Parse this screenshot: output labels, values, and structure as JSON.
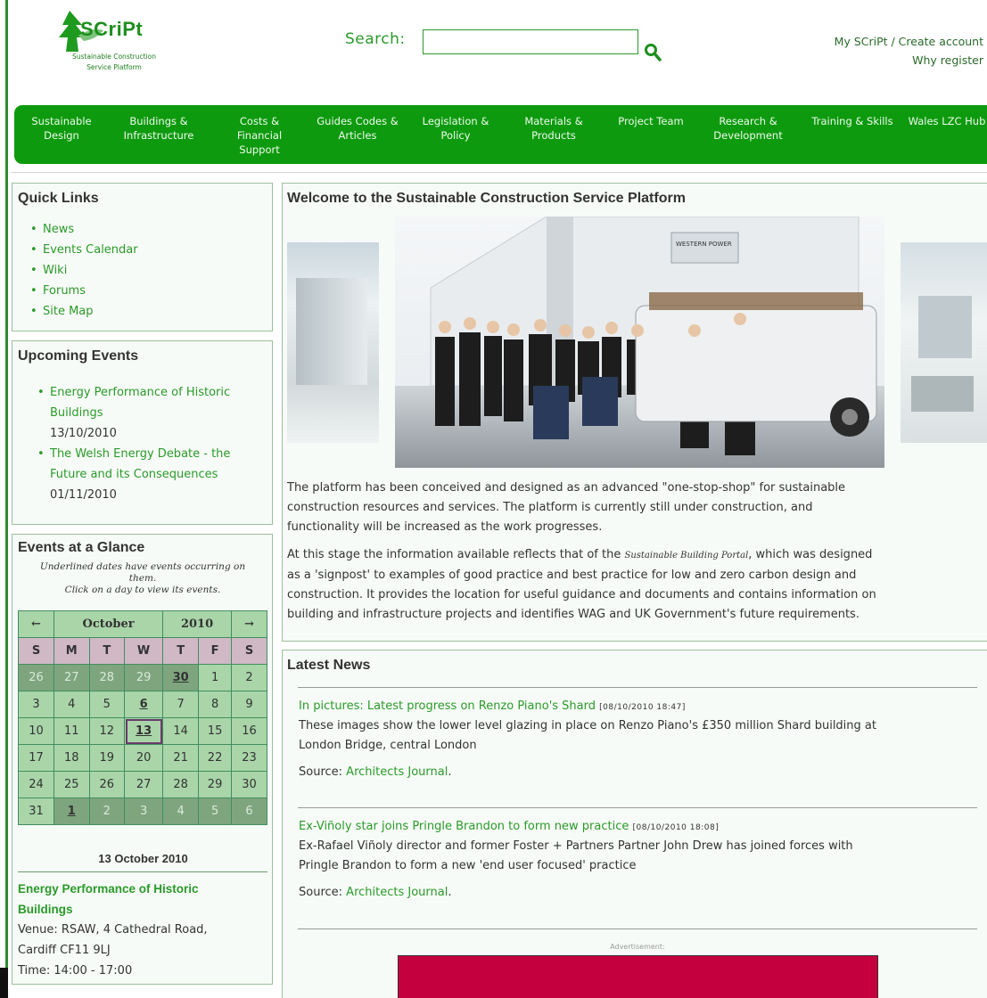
{
  "header": {
    "logo_text": "SCriPt",
    "logo_sub_line1": "Sustainable Construction",
    "logo_sub_line2": "Service Platform",
    "search_label": "Search:",
    "search_value": "",
    "account_links": "My SCriPt / Create account",
    "why_register": "Why register"
  },
  "nav": {
    "items": [
      {
        "line1": "Sustainable",
        "line2": "Design",
        "line3": ""
      },
      {
        "line1": "Buildings &",
        "line2": "Infrastructure",
        "line3": ""
      },
      {
        "line1": "Costs &",
        "line2": "Financial",
        "line3": "Support"
      },
      {
        "line1": "Guides Codes &",
        "line2": "Articles",
        "line3": ""
      },
      {
        "line1": "Legislation &",
        "line2": "Policy",
        "line3": ""
      },
      {
        "line1": "Materials &",
        "line2": "Products",
        "line3": ""
      },
      {
        "line1": "Project Team",
        "line2": "",
        "line3": ""
      },
      {
        "line1": "Research &",
        "line2": "Development",
        "line3": ""
      },
      {
        "line1": "Training & Skills",
        "line2": "",
        "line3": ""
      },
      {
        "line1": "Wales LZC Hub",
        "line2": "",
        "line3": ""
      }
    ]
  },
  "quick_links": {
    "title": "Quick Links",
    "items": [
      "News",
      "Events Calendar",
      "Wiki",
      "Forums",
      "Site Map"
    ]
  },
  "upcoming": {
    "title": "Upcoming Events",
    "events": [
      {
        "line1": "Energy Performance of Historic",
        "line2": "Buildings",
        "date": "13/10/2010"
      },
      {
        "line1": "The Welsh Energy Debate - the",
        "line2": "Future and its Consequences",
        "date": "01/11/2010"
      }
    ]
  },
  "glance": {
    "title": "Events at a Glance",
    "hint_line1": "Underlined dates have events occurring on",
    "hint_line2": "them.",
    "hint_line3": "Click on a day to view its events.",
    "prev": "←",
    "next": "→",
    "month": "October",
    "year": "2010",
    "dow": [
      "S",
      "M",
      "T",
      "W",
      "T",
      "F",
      "S"
    ],
    "weeks": [
      [
        "26",
        "27",
        "28",
        "29",
        "30",
        "1",
        "2"
      ],
      [
        "3",
        "4",
        "5",
        "6",
        "7",
        "8",
        "9"
      ],
      [
        "10",
        "11",
        "12",
        "13",
        "14",
        "15",
        "16"
      ],
      [
        "17",
        "18",
        "19",
        "20",
        "21",
        "22",
        "23"
      ],
      [
        "24",
        "25",
        "26",
        "27",
        "28",
        "29",
        "30"
      ],
      [
        "31",
        "1",
        "2",
        "3",
        "4",
        "5",
        "6"
      ]
    ],
    "selected_date": "13 October 2010",
    "event_title_line1": "Energy Performance of Historic",
    "event_title_line2": "Buildings",
    "venue_line1": "Venue: RSAW, 4 Cathedral Road,",
    "venue_line2": "Cardiff CF11 9LJ",
    "time": "Time: 14:00 - 17:00"
  },
  "welcome": {
    "title": "Welcome to the Sustainable Construction Service Platform",
    "p1_l1": "The platform has been conceived and designed as an advanced \"one-stop-shop\" for sustainable",
    "p1_l2": "construction resources and services. The platform is currently still under construction, and",
    "p1_l3": "functionality will be increased as the work progresses.",
    "p2_l1_a": "At this stage the information available reflects that of the ",
    "p2_l1_em": "Sustainable Building Portal",
    "p2_l1_b": ", which was designed",
    "p2_l2": "as a 'signpost' to examples of good practice and best practice for low and zero carbon design and",
    "p2_l3": "construction. It provides the location for useful guidance and documents and contains information on",
    "p2_l4": "building and infrastructure projects and identifies WAG and UK Government's future requirements.",
    "photo_sign": "WESTERN POWER"
  },
  "news": {
    "title": "Latest News",
    "items": [
      {
        "headline": "In pictures: Latest progress on Renzo Piano's Shard",
        "date": "[08/10/2010 18:47]",
        "body_l1": "These images show the lower level glazing in place on Renzo Piano's £350 million Shard building at",
        "body_l2": "London Bridge, central London",
        "source_label": "Source: ",
        "source": "Architects Journal",
        "source_end": "."
      },
      {
        "headline": "Ex-Viñoly star joins Pringle Brandon to form new practice",
        "date": "[08/10/2010 18:08]",
        "body_l1": "Ex-Rafael Viñoly director and former Foster + Partners Partner John Drew has joined forces with",
        "body_l2": "Pringle Brandon to form a new 'end user focused' practice",
        "source_label": "Source: ",
        "source": "Architects Journal",
        "source_end": "."
      }
    ],
    "ad_label": "Advertisement:"
  }
}
